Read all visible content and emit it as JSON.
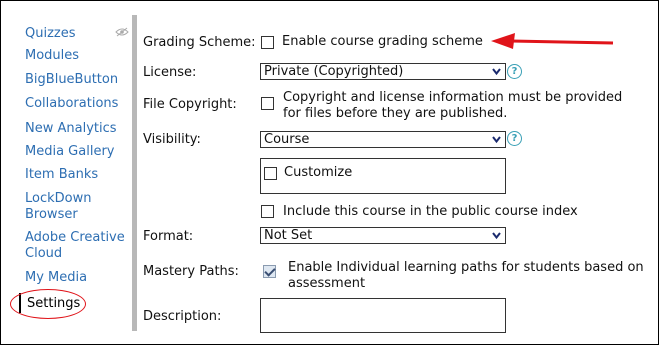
{
  "sidebar": {
    "items": [
      {
        "label": "Quizzes"
      },
      {
        "label": "Modules"
      },
      {
        "label": "BigBlueButton"
      },
      {
        "label": "Collaborations"
      },
      {
        "label": "New Analytics"
      },
      {
        "label": "Media Gallery"
      },
      {
        "label": "Item Banks"
      },
      {
        "label": "LockDown"
      },
      {
        "label": "Browser"
      },
      {
        "label": "Adobe Creative"
      },
      {
        "label": "Cloud"
      },
      {
        "label": "My Media"
      }
    ],
    "active": {
      "label": "Settings"
    }
  },
  "form": {
    "grading_scheme": {
      "label": "Grading Scheme:",
      "checkbox_label": "Enable course grading scheme",
      "checked": false
    },
    "license": {
      "label": "License:",
      "value": "Private (Copyrighted)"
    },
    "file_copyright": {
      "label": "File Copyright:",
      "line1": "Copyright and license information must be provided",
      "line2": "for files before they are published.",
      "checked": false
    },
    "visibility": {
      "label": "Visibility:",
      "value": "Course",
      "customize_label": "Customize",
      "public_index_label": "Include this course in the public course index"
    },
    "format": {
      "label": "Format:",
      "value": "Not Set"
    },
    "mastery_paths": {
      "label": "Mastery Paths:",
      "line1": "Enable Individual learning paths for students based on",
      "line2": "assessment",
      "checked": true
    },
    "description": {
      "label": "Description:",
      "value": ""
    }
  },
  "help_glyph": "?",
  "colors": {
    "link": "#2d6eb2",
    "annotation": "#e0141a",
    "help": "#3aa0b6"
  },
  "icons": {
    "hidden": "eye-slash-icon",
    "dropdown": "chevron-down-icon",
    "help": "question-circle-icon",
    "annotation": "red-arrow-annotation"
  }
}
